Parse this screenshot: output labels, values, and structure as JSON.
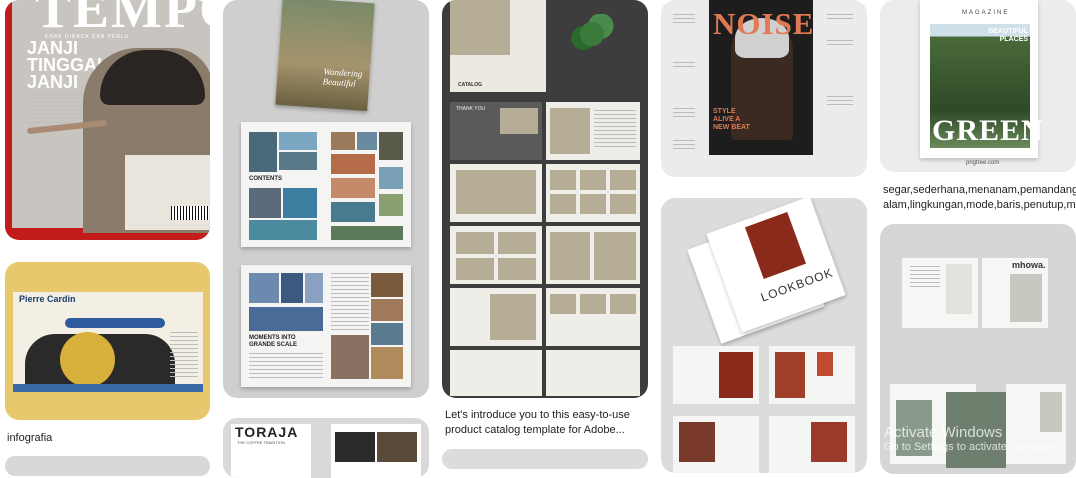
{
  "pins": [
    {
      "id": "tempo",
      "masthead": "TEMPO",
      "tagline": "ENAK DIBACA DAN PERLU",
      "headline": [
        "JANJI",
        "TINGGAL",
        "JANJI"
      ]
    },
    {
      "id": "infografia",
      "heading": "Pierre Cardin",
      "caption": "infografia"
    },
    {
      "id": "travel",
      "cover_script": "Wandering Beautiful",
      "section": "CONTENTS",
      "feature": "MOMENTS INTO GRANDE SCALE"
    },
    {
      "id": "toraja",
      "title": "TORAJA",
      "subtitle": "THE COFFEE TRADITION"
    },
    {
      "id": "catalog",
      "labels": [
        "CATALOG",
        "THANK YOU"
      ],
      "caption": "Let's introduce you to this easy-to-use product catalog template for Adobe..."
    },
    {
      "id": "noise",
      "masthead": "NOISE",
      "coverline": "STYLE ALIVE A NEW BEAT"
    },
    {
      "id": "lookbook",
      "title": "LOOKBOOK"
    },
    {
      "id": "green",
      "masthead": "MAGAZINE",
      "title": "GREEN",
      "coverline": "BEAUTIFUL PLACES",
      "source": "pngtree.com",
      "caption": "segar,sederhana,menanam,pemandangan alam,lingkungan,mode,baris,penutup,maj..."
    },
    {
      "id": "mhowa",
      "title": "mhowa."
    }
  ],
  "watermark": {
    "line1": "Activate Windows",
    "line2": "Go to Settings to activate Windows."
  }
}
